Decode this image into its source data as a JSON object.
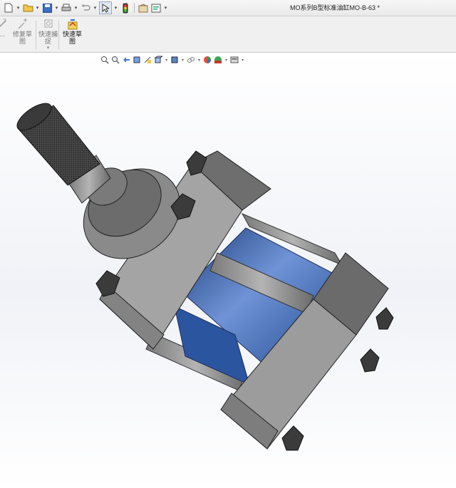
{
  "window": {
    "title": "MO系列B型标准油缸MO-B-63 *"
  },
  "quick_access": {
    "icons": [
      "new-document-icon",
      "open-folder-icon",
      "save-icon",
      "print-icon",
      "undo-icon",
      "select-arrow-icon",
      "rebuild-traffic-light-icon",
      "file-properties-icon",
      "options-icon"
    ]
  },
  "ribbon": {
    "items": [
      {
        "label": "...",
        "icon": "sketch-icon",
        "enabled": false
      },
      {
        "label": "修复草\n图",
        "icon": "repair-sketch-icon",
        "enabled": false
      },
      {
        "label": "快速捕\n捉",
        "icon": "quick-snap-icon",
        "enabled": false
      },
      {
        "label": "快速草\n图",
        "icon": "rapid-sketch-icon",
        "enabled": true
      }
    ]
  },
  "view_toolbar": {
    "icons": [
      "zoom-to-fit-icon",
      "zoom-to-area-icon",
      "previous-view-icon",
      "section-view-icon",
      "dynamic-annotation-icon",
      "view-orientation-icon",
      "display-style-icon",
      "hide-show-items-icon",
      "edit-appearance-icon",
      "apply-scene-icon",
      "view-settings-icon"
    ]
  },
  "model": {
    "name": "hydraulic-cylinder",
    "colors": {
      "steel": "#8f8f8f",
      "steel_dark": "#5a5a5a",
      "barrel": "#2f5aa8",
      "barrel_light": "#6f93d6",
      "bolt": "#3a3a3a"
    }
  }
}
